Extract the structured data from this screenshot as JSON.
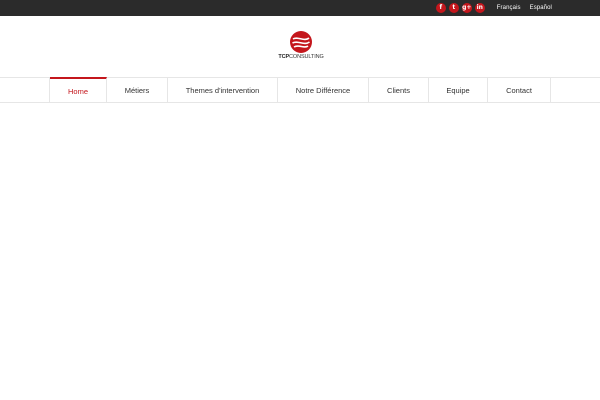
{
  "topbar": {
    "socials": [
      {
        "icon": "facebook-icon",
        "glyph": "f"
      },
      {
        "icon": "twitter-icon",
        "glyph": "t"
      },
      {
        "icon": "google-plus-icon",
        "glyph": "g+"
      },
      {
        "icon": "linkedin-icon",
        "glyph": "in"
      }
    ],
    "languages": [
      "Français",
      "Español"
    ]
  },
  "header": {
    "logo_bold": "TCP",
    "logo_rest": "CONSULTING"
  },
  "nav": {
    "items": [
      {
        "label": "Home",
        "active": true
      },
      {
        "label": "Métiers"
      },
      {
        "label": "Themes d'intervention"
      },
      {
        "label": "Notre Différence"
      },
      {
        "label": "Clients"
      },
      {
        "label": "Equipe"
      },
      {
        "label": "Contact"
      }
    ]
  },
  "colors": {
    "accent": "#c4161c",
    "topbar": "#2b2b2b",
    "border": "#e6e6e6",
    "text": "#333333"
  }
}
